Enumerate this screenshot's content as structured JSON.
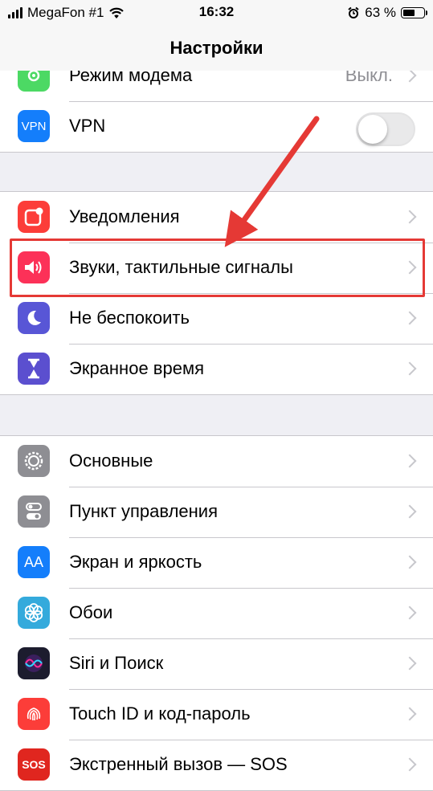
{
  "status_bar": {
    "carrier": "MegaFon #1",
    "time": "16:32",
    "battery": "63 %",
    "battery_level": 0.63
  },
  "nav": {
    "title": "Настройки"
  },
  "colors": {
    "hotspot": "#4cd964",
    "vpn": "#147efb",
    "notifications": "#fc3d39",
    "sounds": "#fc3158",
    "dnd": "#5856d6",
    "screen_time": "#5b4fcf",
    "general": "#8e8e93",
    "control_center": "#8e8e93",
    "display": "#147efb",
    "wallpaper": "#34aadc",
    "siri": "#1c1c2e",
    "touchid": "#fc3d39",
    "sos": "#e0261f",
    "highlight": "#e53935"
  },
  "group1": [
    {
      "label": "Режим модема",
      "value": "Выкл.",
      "icon": "hotspot-icon"
    },
    {
      "label": "VPN",
      "icon_text": "VPN",
      "toggle": false
    }
  ],
  "group2": [
    {
      "label": "Уведомления",
      "icon": "notifications-icon"
    },
    {
      "label": "Звуки, тактильные сигналы",
      "icon": "sound-icon"
    },
    {
      "label": "Не беспокоить",
      "icon": "moon-icon"
    },
    {
      "label": "Экранное время",
      "icon": "hourglass-icon"
    }
  ],
  "group3": [
    {
      "label": "Основные",
      "icon": "gear-icon"
    },
    {
      "label": "Пункт управления",
      "icon": "toggles-icon"
    },
    {
      "label": "Экран и яркость",
      "icon": "display-icon",
      "icon_text": "AA"
    },
    {
      "label": "Обои",
      "icon": "flower-icon"
    },
    {
      "label": "Siri и Поиск",
      "icon": "siri-icon"
    },
    {
      "label": "Touch ID и код-пароль",
      "icon": "fingerprint-icon"
    },
    {
      "label": "Экстренный вызов — SOS",
      "icon": "sos-icon",
      "icon_text": "SOS"
    }
  ]
}
